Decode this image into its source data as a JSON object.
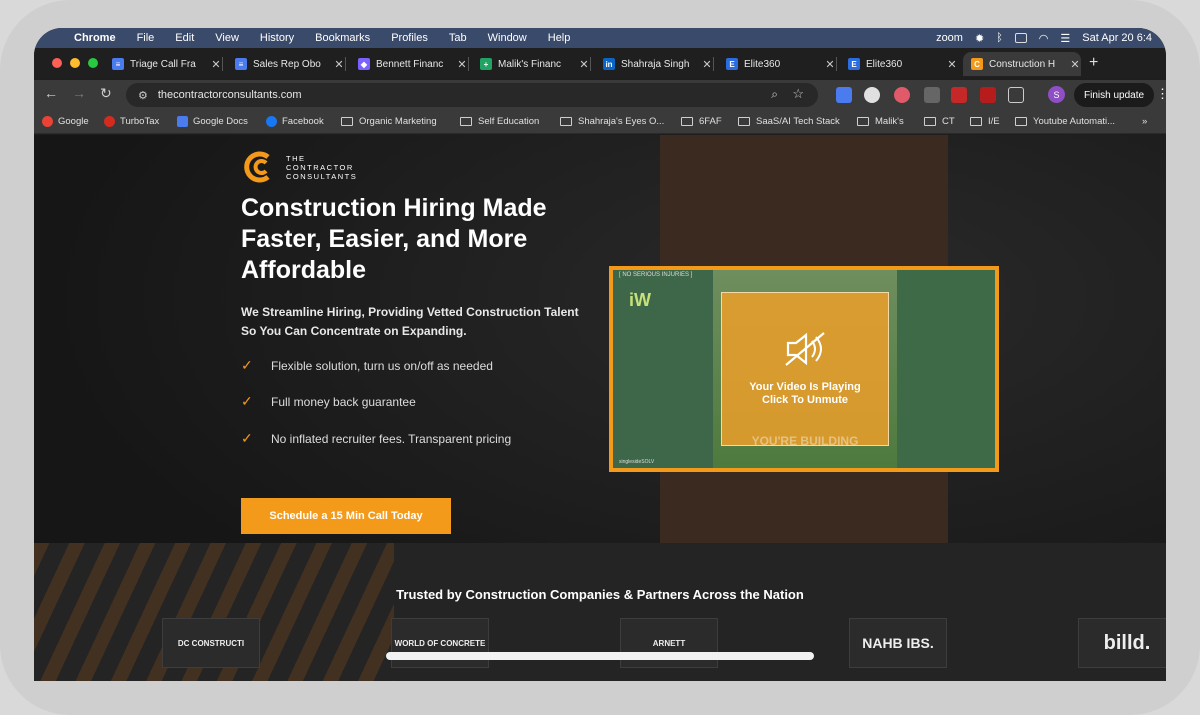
{
  "menubar": {
    "app": "Chrome",
    "items": [
      "File",
      "Edit",
      "View",
      "History",
      "Bookmarks",
      "Profiles",
      "Tab",
      "Window",
      "Help"
    ],
    "zoom": "zoom",
    "datetime": "Sat Apr 20  6:4"
  },
  "tabs": [
    {
      "title": "Triage Call Fra",
      "color": "#4a7cf0"
    },
    {
      "title": "Sales Rep Obo",
      "color": "#4a7cf0"
    },
    {
      "title": "Bennett Financ",
      "color": "#7b61ff"
    },
    {
      "title": "Malik's Financ",
      "color": "#1fa463"
    },
    {
      "title": "Shahraja Singh",
      "color": "#0a66c2"
    },
    {
      "title": "Elite360",
      "color": "#2b6de0"
    },
    {
      "title": "Elite360",
      "color": "#2b6de0"
    },
    {
      "title": "Construction H",
      "color": "#f39a1b"
    }
  ],
  "toolbar": {
    "url": "thecontractorconsultants.com",
    "profile_initial": "S",
    "finish_update": "Finish update"
  },
  "bookmarks": [
    {
      "label": "Google",
      "type": "site",
      "color": "#ea4335"
    },
    {
      "label": "TurboTax",
      "type": "site",
      "color": "#d52b1e"
    },
    {
      "label": "Google Docs",
      "type": "site",
      "color": "#4a7cf0"
    },
    {
      "label": "Facebook",
      "type": "site",
      "color": "#1877f2"
    },
    {
      "label": "Organic Marketing",
      "type": "folder"
    },
    {
      "label": "Self Education",
      "type": "folder"
    },
    {
      "label": "Shahraja's Eyes O...",
      "type": "folder"
    },
    {
      "label": "6FAF",
      "type": "folder"
    },
    {
      "label": "SaaS/AI Tech Stack",
      "type": "folder"
    },
    {
      "label": "Malik's",
      "type": "folder"
    },
    {
      "label": "CT",
      "type": "folder"
    },
    {
      "label": "I/E",
      "type": "folder"
    },
    {
      "label": "Youtube Automati...",
      "type": "folder"
    }
  ],
  "page": {
    "logo_text": [
      "THE",
      "CONTRACTOR",
      "CONSULTANTS"
    ],
    "headline": "Construction Hiring Made Faster, Easier, and More Affordable",
    "subhead": "We Streamline Hiring, Providing Vetted Construction Talent So You Can Concentrate on Expanding.",
    "bullets": [
      "Flexible solution, turn us on/off as needed",
      "Full money back guarantee",
      "No inflated recruiter fees. Transparent pricing"
    ],
    "cta": "Schedule a 15 Min Call Today",
    "video": {
      "tag": "[ NO SERIOUS INJURIES ]",
      "brand": "iW",
      "message_line1": "Your Video Is Playing",
      "message_line2": "Click To Unmute",
      "caption": "YOU'RE BUILDING",
      "handle": "singlesideSOLV"
    },
    "trust_title": "Trusted by Construction Companies & Partners Across the Nation",
    "partners": [
      "DC CONSTRUCTI",
      "WORLD OF CONCRETE",
      "ARNETT",
      "NAHB IBS.",
      "billd."
    ]
  },
  "colors": {
    "accent": "#f39a1b"
  }
}
